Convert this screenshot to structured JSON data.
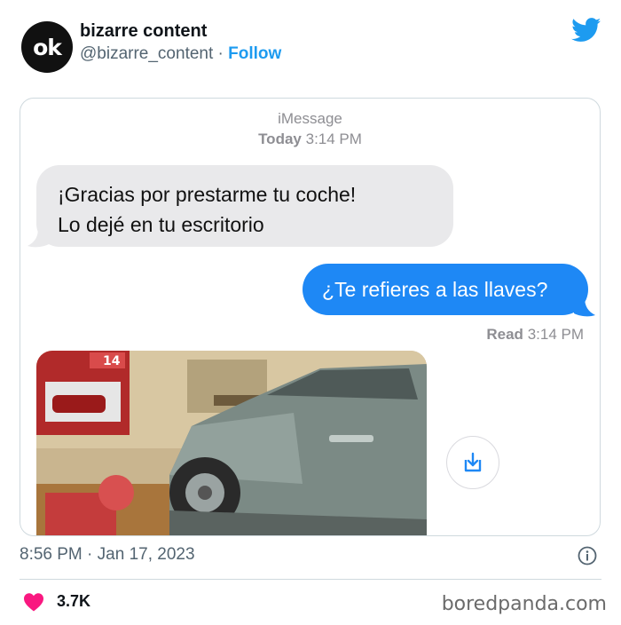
{
  "author": {
    "avatar_text": "ok",
    "name": "bizarre content",
    "handle": "@bizarre_content",
    "separator": " · ",
    "follow_label": "Follow"
  },
  "message": {
    "service": "iMessage",
    "day": "Today",
    "time": "3:14 PM",
    "incoming_line1": "¡Gracias por prestarme tu coche!",
    "incoming_line2": "Lo dejé en tu escritorio",
    "outgoing": "¿Te refieres a las llaves?",
    "read_label": "Read",
    "read_time": "3:14 PM",
    "photo_caption": "car crashed into bedroom",
    "photo_banner_number": "14"
  },
  "tweet": {
    "time": "8:56 PM",
    "date": "Jan 17, 2023",
    "separator": " · ",
    "likes": "3.7K"
  },
  "watermark": "boredpanda.com",
  "icons": {
    "brand": "twitter-bird-icon",
    "download": "download-icon",
    "info": "info-icon",
    "like": "heart-icon"
  },
  "colors": {
    "twitter_blue": "#1d9bf0",
    "imessage_blue": "#1e88f5",
    "incoming_gray": "#e9e9eb",
    "heart": "#f91880"
  }
}
